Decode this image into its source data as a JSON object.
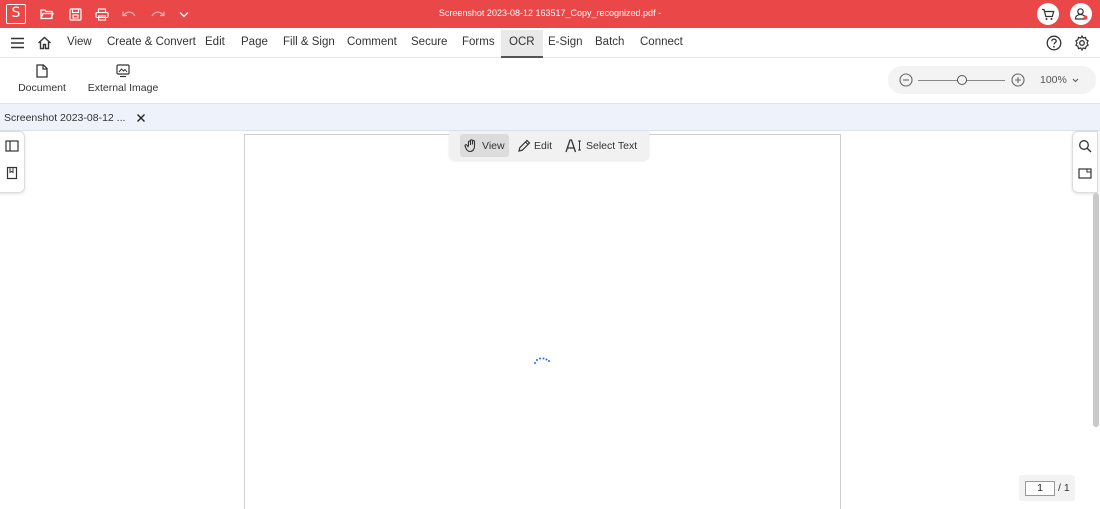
{
  "titlebar": {
    "logo_letter": "S",
    "window_title": "Screenshot 2023-08-12 163517_Copy_recognized.pdf -",
    "accent_color": "#e94748"
  },
  "menubar": {
    "items": [
      "View",
      "Create & Convert",
      "Edit",
      "Page",
      "Fill & Sign",
      "Comment",
      "Secure",
      "Forms",
      "OCR",
      "E-Sign",
      "Batch",
      "Connect"
    ],
    "active": "OCR"
  },
  "ribbon": {
    "document_label": "Document",
    "external_image_label": "External Image",
    "zoom_level": "100%",
    "zoom_slider_position_percent": 50
  },
  "tabs": {
    "document_tab_title": "Screenshot 2023-08-12 ..."
  },
  "viewer": {
    "mode_view": "View",
    "mode_edit": "Edit",
    "mode_select_text": "Select Text",
    "current_page": "1",
    "total_pages": "/ 1"
  },
  "icons": {
    "menu": "hamburger-icon",
    "home": "home-icon",
    "help": "help-icon",
    "settings": "gear-icon",
    "cart": "cart-icon",
    "account": "user-icon"
  }
}
